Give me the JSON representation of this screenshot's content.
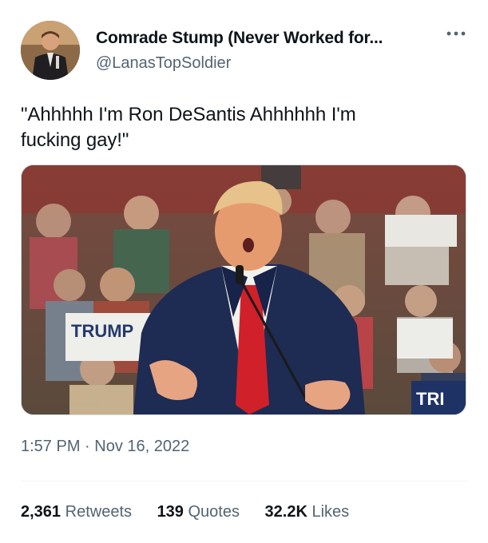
{
  "author": {
    "display_name": "Comrade Stump (Never Worked for...",
    "handle": "@LanasTopSoldier",
    "avatar_icon": "profile-avatar"
  },
  "more_icon": "more-horizontal-icon",
  "tweet": {
    "text": "\"Ahhhhh I'm Ron DeSantis Ahhhhhh I'm\nfucking gay!\"",
    "media_sign_text": "TRUMP"
  },
  "meta": {
    "time": "1:57 PM",
    "separator": "·",
    "date": "Nov 16, 2022"
  },
  "stats": {
    "retweets": {
      "count": "2,361",
      "label": "Retweets"
    },
    "quotes": {
      "count": "139",
      "label": "Quotes"
    },
    "likes": {
      "count": "32.2K",
      "label": "Likes"
    }
  },
  "colors": {
    "text": "#0f1419",
    "secondary": "#536471",
    "divider": "#eff3f4",
    "suit": "#1e2b52",
    "tie": "#d0202a"
  }
}
